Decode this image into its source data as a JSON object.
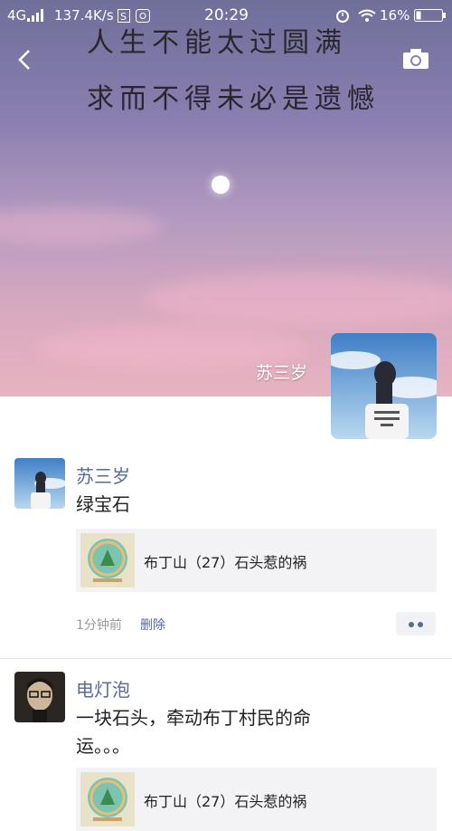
{
  "status_bar": {
    "network": "4G",
    "speed": "137.4K/s",
    "time": "20:29",
    "battery": "16%"
  },
  "cover": {
    "quote_line1": "人生不能太过圆满",
    "quote_line2": "求而不得未必是遗憾"
  },
  "profile": {
    "name": "苏三岁"
  },
  "posts": [
    {
      "author": "苏三岁",
      "text": "绿宝石",
      "link_title": "布丁山（27）石头惹的祸",
      "time": "1分钟前",
      "delete_label": "删除"
    },
    {
      "author": "电灯泡",
      "text_line1": "一块石头，牵动布丁村民的命",
      "text_line2": "运。。。",
      "link_title": "布丁山（27）石头惹的祸"
    }
  ],
  "colors": {
    "link_blue": "#576b95",
    "cover_top": "#6f6f9a",
    "cover_bottom": "#e6b3c0"
  }
}
